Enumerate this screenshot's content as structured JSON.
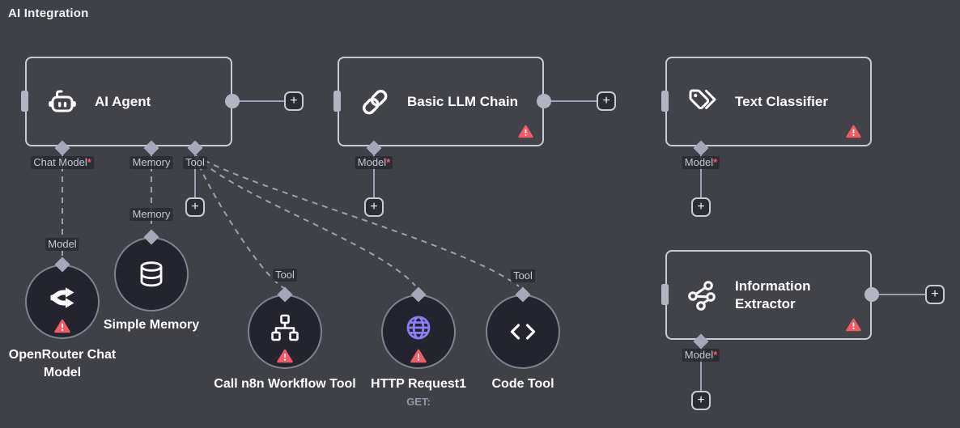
{
  "title": "AI Integration",
  "nodes": {
    "ai_agent": {
      "label": "AI Agent"
    },
    "basic_llm_chain": {
      "label": "Basic LLM Chain"
    },
    "text_classifier": {
      "label": "Text Classifier"
    },
    "information_extractor": {
      "label": "Information Extractor"
    },
    "openrouter_chat_model": {
      "label": "OpenRouter Chat Model"
    },
    "simple_memory": {
      "label": "Simple Memory"
    },
    "call_n8n_workflow_tool": {
      "label": "Call n8n Workflow Tool"
    },
    "http_request1": {
      "label": "HTTP Request1",
      "subtitle": "GET:"
    },
    "code_tool": {
      "label": "Code Tool"
    }
  },
  "connector_labels": {
    "chat_model": "Chat Model",
    "memory": "Memory",
    "tool": "Tool",
    "model": "Model",
    "required_marker": "*"
  },
  "buttons": {
    "add_label": "+"
  },
  "icons": [
    "robot-icon",
    "chain-link-icon",
    "tags-icon",
    "share-nodes-icon",
    "fork-arrows-icon",
    "database-icon",
    "sitemap-icon",
    "globe-icon",
    "code-brackets-icon",
    "warning-triangle-icon",
    "plus-icon"
  ],
  "colors": {
    "canvas_bg": "#3f4146",
    "node_border": "#c8cbd4",
    "circle_node_fill": "#23242e",
    "circle_node_border": "#80838f",
    "connector_endpoint": "#a4a8ba",
    "connection_line": "#9aa0b2",
    "warning_red": "#f25a68",
    "required_asterisk_red": "#f25a63",
    "http_globe_purple": "#8b7df2",
    "chip_text": "#c3c7d6",
    "subtitle_text": "#9298a8"
  }
}
